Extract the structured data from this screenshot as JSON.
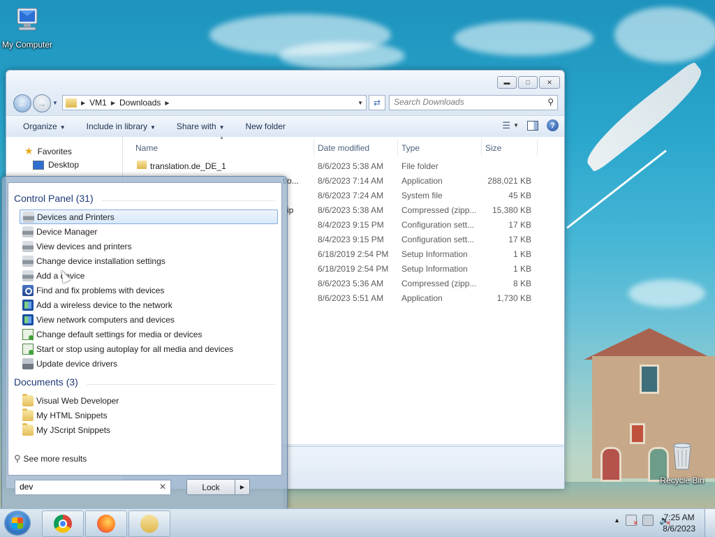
{
  "desktop": {
    "icons": [
      {
        "label": "My Computer"
      },
      {
        "label": "Recycle Bin"
      }
    ]
  },
  "explorer": {
    "breadcrumb": [
      "VM1",
      "Downloads"
    ],
    "search_placeholder": "Search Downloads",
    "toolbar": {
      "organize": "Organize",
      "include_in_library": "Include in library",
      "share_with": "Share with",
      "new_folder": "New folder"
    },
    "nav": {
      "favorites": "Favorites",
      "desktop": "Desktop"
    },
    "columns": {
      "name": "Name",
      "date": "Date modified",
      "type": "Type",
      "size": "Size"
    },
    "files": [
      {
        "name": "translation.de_DE_1",
        "date": "8/6/2023 5:38 AM",
        "type": "File folder",
        "size": ""
      },
      {
        "name": "tio...",
        "date": "8/6/2023 7:14 AM",
        "type": "Application",
        "size": "288,021 KB"
      },
      {
        "name": "",
        "date": "8/6/2023 7:24 AM",
        "type": "System file",
        "size": "45 KB"
      },
      {
        "name": "ip",
        "date": "8/6/2023 5:38 AM",
        "type": "Compressed (zipp...",
        "size": "15,380 KB"
      },
      {
        "name": "",
        "date": "8/4/2023 9:15 PM",
        "type": "Configuration sett...",
        "size": "17 KB"
      },
      {
        "name": "",
        "date": "8/4/2023 9:15 PM",
        "type": "Configuration sett...",
        "size": "17 KB"
      },
      {
        "name": "",
        "date": "6/18/2019 2:54 PM",
        "type": "Setup Information",
        "size": "1 KB"
      },
      {
        "name": "",
        "date": "6/18/2019 2:54 PM",
        "type": "Setup Information",
        "size": "1 KB"
      },
      {
        "name": "",
        "date": "8/6/2023 5:36 AM",
        "type": "Compressed (zipp...",
        "size": "8 KB"
      },
      {
        "name": "",
        "date": "8/6/2023 5:51 AM",
        "type": "Application",
        "size": "1,730 KB"
      }
    ]
  },
  "start_menu": {
    "groups": [
      {
        "title": "Control Panel (31)",
        "items": [
          {
            "label": "Devices and Printers",
            "icon": "printer-icon",
            "selected": true
          },
          {
            "label": "Device Manager",
            "icon": "printer-icon"
          },
          {
            "label": "View devices and printers",
            "icon": "printer-icon"
          },
          {
            "label": "Change device installation settings",
            "icon": "printer-icon"
          },
          {
            "label": "Add a device",
            "icon": "printer-icon"
          },
          {
            "label": "Find and fix problems with devices",
            "icon": "troubleshoot-icon"
          },
          {
            "label": "Add a wireless device to the network",
            "icon": "network-icon"
          },
          {
            "label": "View network computers and devices",
            "icon": "network-icon"
          },
          {
            "label": "Change default settings for media or devices",
            "icon": "autoplay-icon"
          },
          {
            "label": "Start or stop using autoplay for all media and devices",
            "icon": "autoplay-icon"
          },
          {
            "label": "Update device drivers",
            "icon": "drivers-icon"
          }
        ]
      },
      {
        "title": "Documents (3)",
        "items": [
          {
            "label": "Visual Web Developer",
            "icon": "folder-icon"
          },
          {
            "label": "My HTML Snippets",
            "icon": "folder-icon"
          },
          {
            "label": "My JScript Snippets",
            "icon": "folder-icon"
          }
        ]
      }
    ],
    "see_more": "See more results",
    "search_value": "dev",
    "lock_label": "Lock"
  },
  "taskbar": {
    "apps": [
      "Google Chrome",
      "Firefox",
      "Windows Explorer"
    ],
    "clock_time": "7:25 AM",
    "clock_date": "8/6/2023"
  }
}
